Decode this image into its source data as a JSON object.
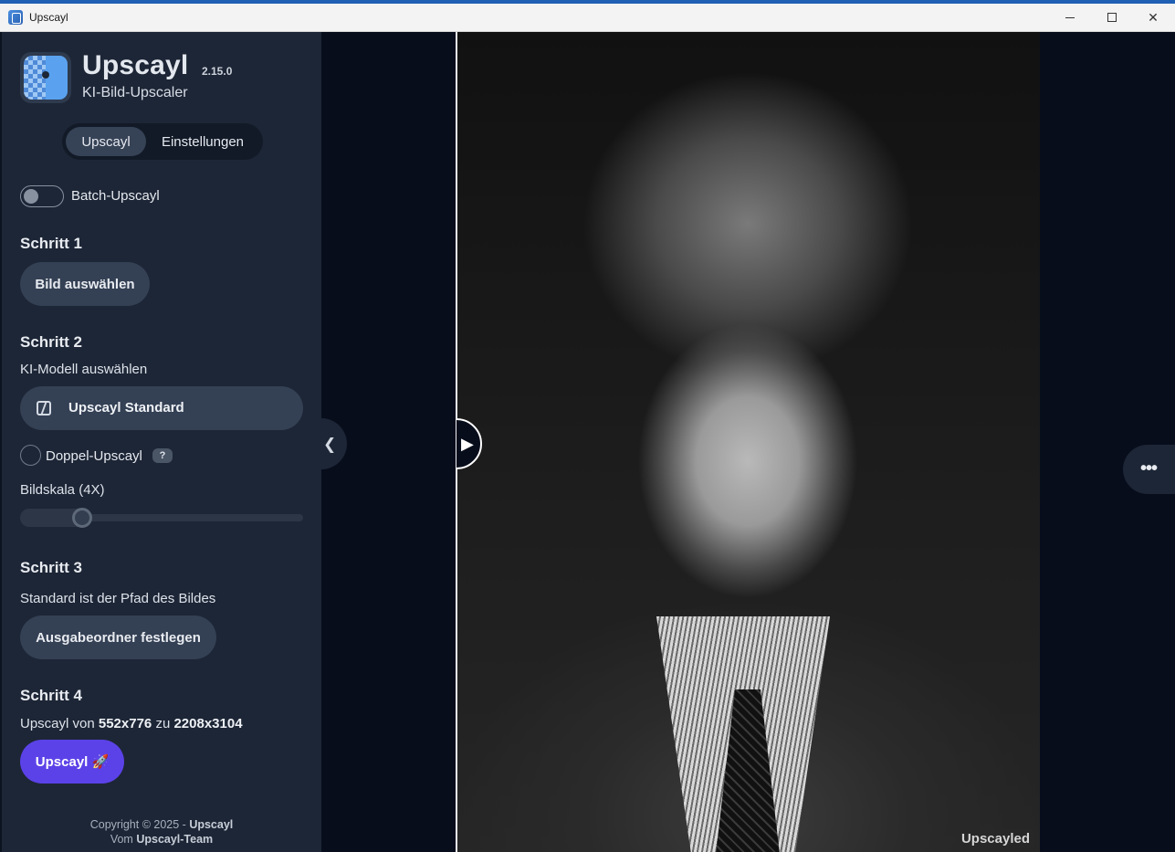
{
  "window": {
    "title": "Upscayl"
  },
  "header": {
    "app_name": "Upscayl",
    "version": "2.15.0",
    "subtitle": "KI-Bild-Upscaler"
  },
  "tabs": [
    {
      "label": "Upscayl",
      "active": true
    },
    {
      "label": "Einstellungen",
      "active": false
    }
  ],
  "batch": {
    "label": "Batch-Upscayl",
    "enabled": false
  },
  "step1": {
    "title": "Schritt 1",
    "button": "Bild auswählen"
  },
  "step2": {
    "title": "Schritt 2",
    "model_label": "KI-Modell auswählen",
    "model_value": "Upscayl Standard",
    "double_label": "Doppel-Upscayl",
    "double_checked": false,
    "help": "?",
    "scale_label": "Bildskala (4X)",
    "scale_fraction": 0.22
  },
  "step3": {
    "title": "Schritt 3",
    "hint": "Standard ist der Pfad des Bildes",
    "button": "Ausgabeordner festlegen"
  },
  "step4": {
    "title": "Schritt 4",
    "prefix": "Upscayl von ",
    "from": "552x776",
    "middle": " zu ",
    "to": "2208x3104",
    "button": "Upscayl 🚀"
  },
  "footer": {
    "line1_prefix": "Copyright © 2025 - ",
    "line1_bold": "Upscayl",
    "line2_prefix": "Vom ",
    "line2_bold": "Upscayl-Team"
  },
  "preview": {
    "badge": "Upscayled"
  },
  "icons": {
    "collapse": "chevron-left-icon",
    "compare": "play-right-icon",
    "more": "more-horizontal-icon",
    "model": "model-swatch-icon"
  },
  "colors": {
    "accent": "#5b42e8",
    "sidebar": "#1d2636",
    "background": "#070d1b"
  }
}
